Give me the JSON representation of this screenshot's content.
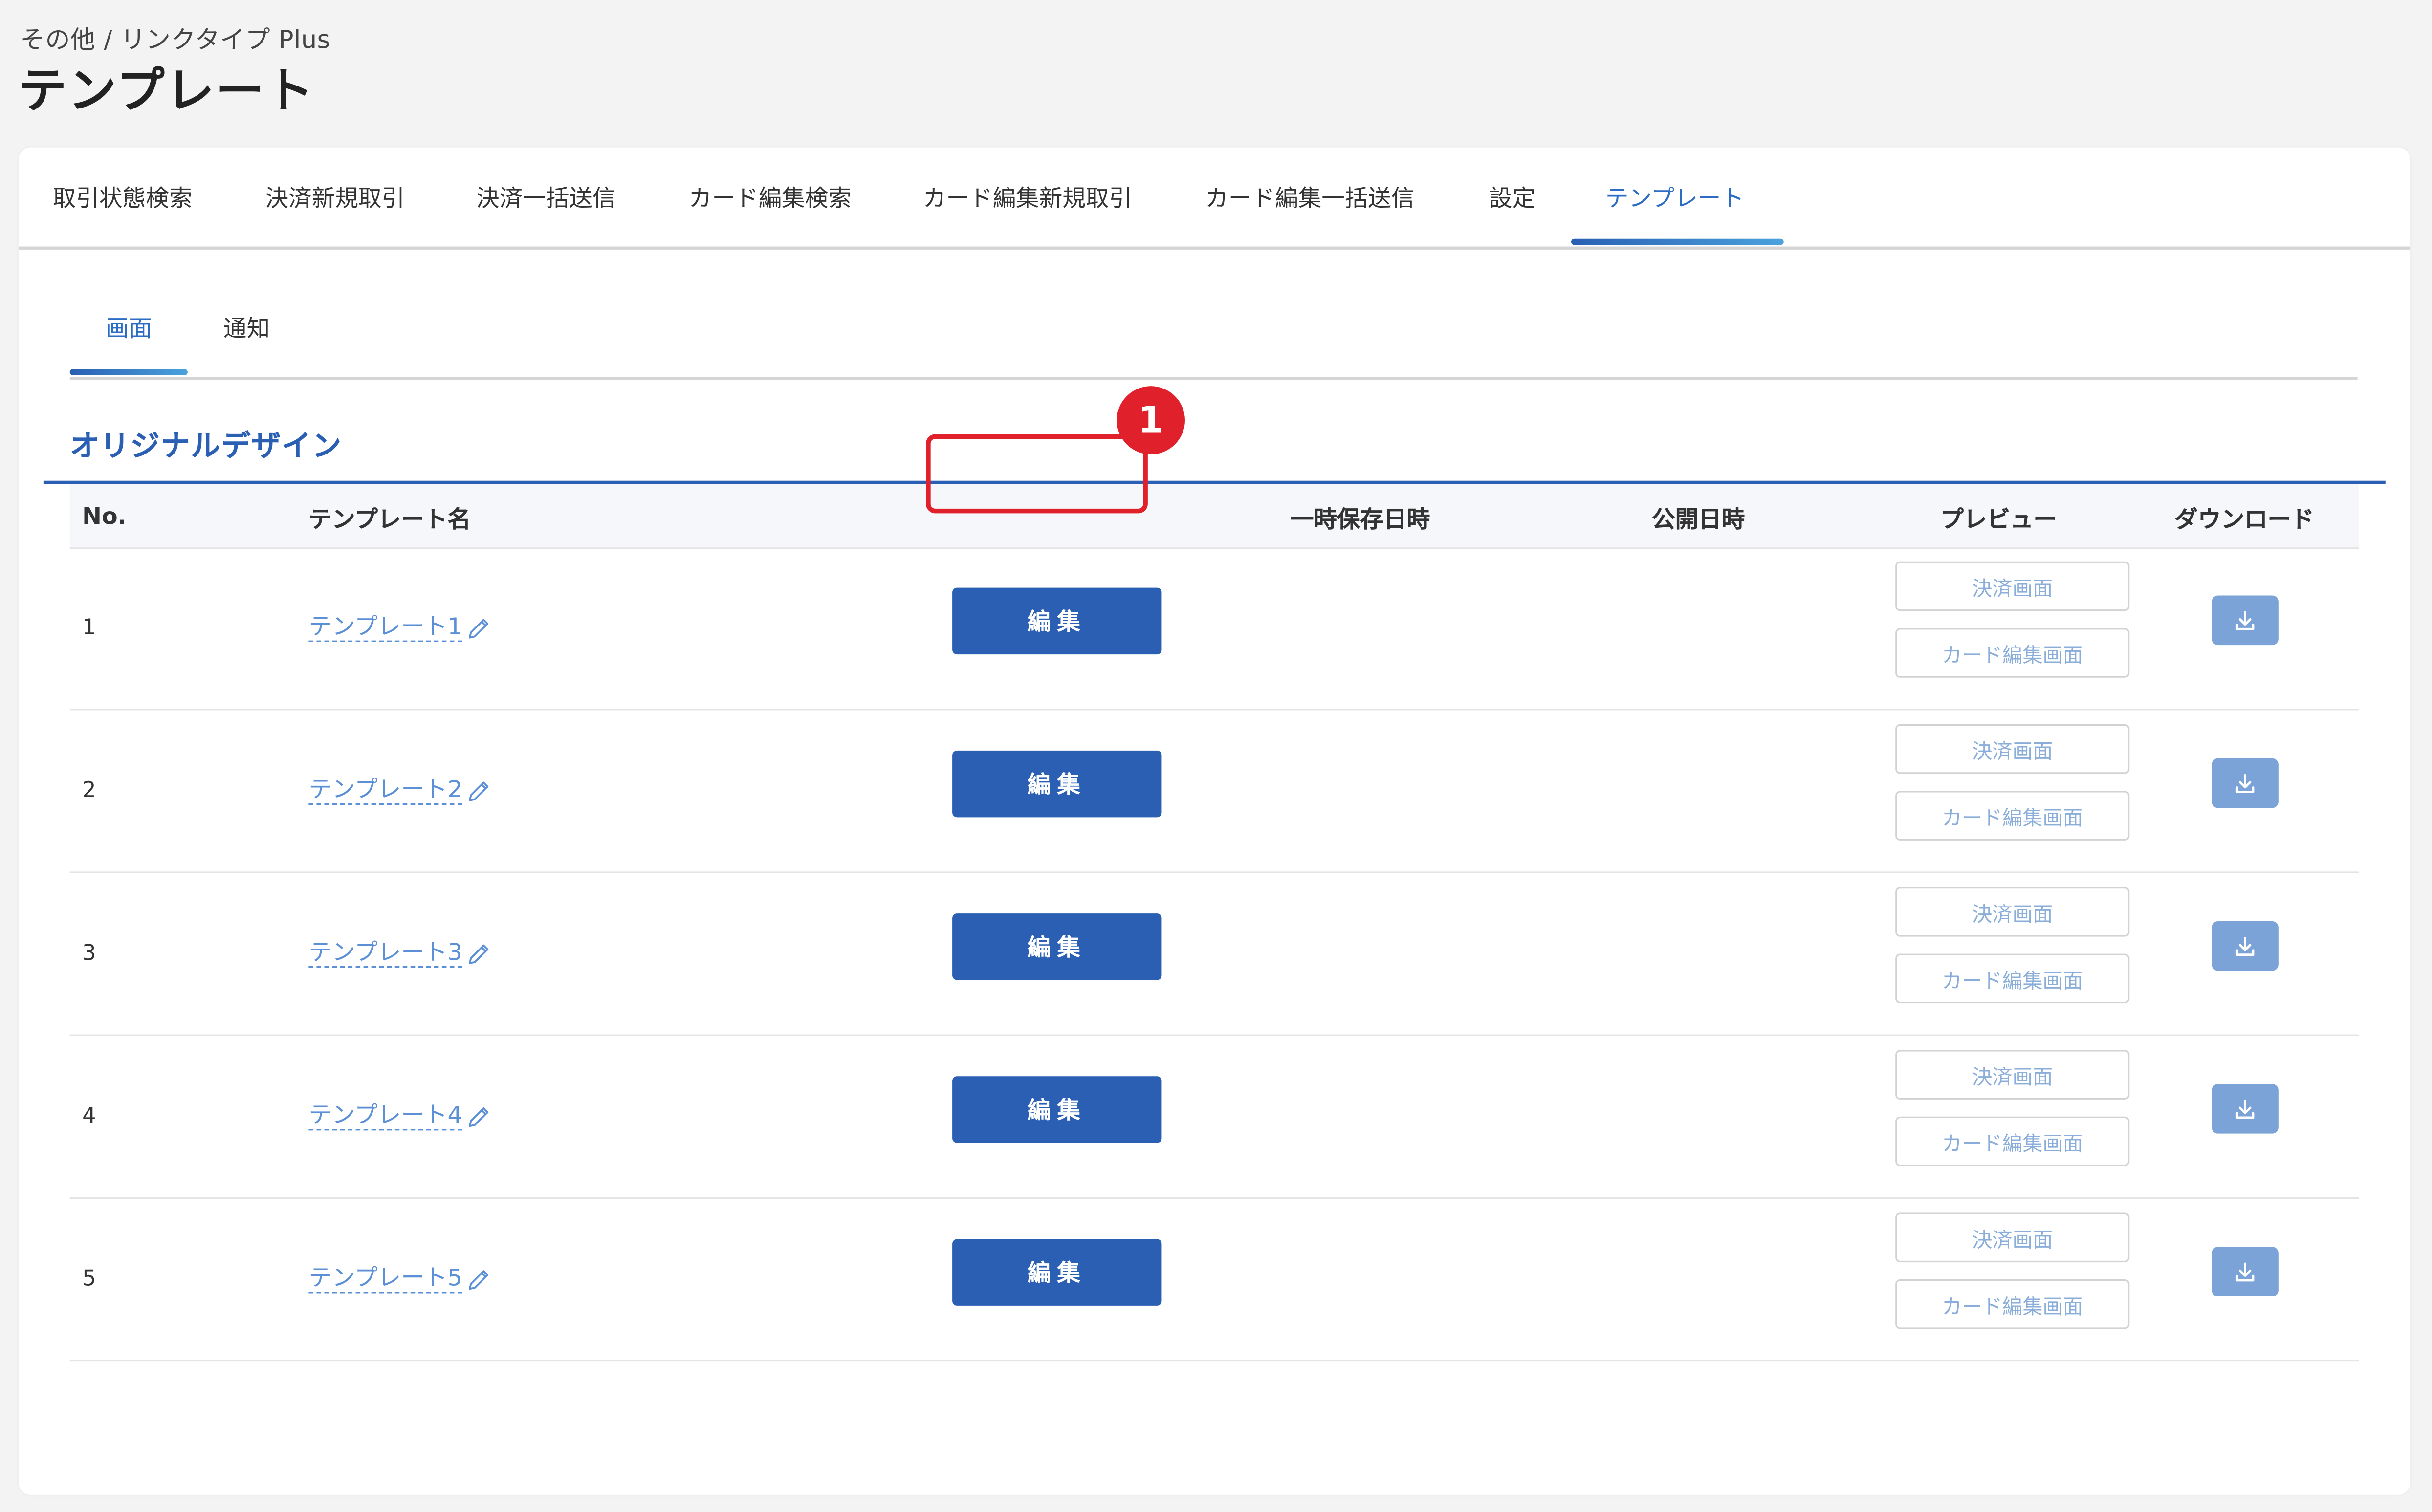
{
  "breadcrumb": "その他 / リンクタイプ Plus",
  "page_title": "テンプレート",
  "main_tabs": [
    "取引状態検索",
    "決済新規取引",
    "決済一括送信",
    "カード編集検索",
    "カード編集新規取引",
    "カード編集一括送信",
    "設定",
    "テンプレート"
  ],
  "main_tab_active": "テンプレート",
  "sub_tabs": [
    "画面",
    "通知"
  ],
  "sub_tab_active": "画面",
  "section_title": "オリジナルデザイン",
  "table": {
    "headers": {
      "no": "No.",
      "name": "テンプレート名",
      "temp_saved": "一時保存日時",
      "published": "公開日時",
      "preview": "プレビュー",
      "download": "ダウンロード"
    },
    "rows": [
      {
        "no": "1",
        "name": "テンプレート1",
        "edit": "編集",
        "preview_payment": "決済画面",
        "preview_card": "カード編集画面"
      },
      {
        "no": "2",
        "name": "テンプレート2",
        "edit": "編集",
        "preview_payment": "決済画面",
        "preview_card": "カード編集画面"
      },
      {
        "no": "3",
        "name": "テンプレート3",
        "edit": "編集",
        "preview_payment": "決済画面",
        "preview_card": "カード編集画面"
      },
      {
        "no": "4",
        "name": "テンプレート4",
        "edit": "編集",
        "preview_payment": "決済画面",
        "preview_card": "カード編集画面"
      },
      {
        "no": "5",
        "name": "テンプレート5",
        "edit": "編集",
        "preview_payment": "決済画面",
        "preview_card": "カード編集画面"
      }
    ]
  },
  "annotation": {
    "badge": "1",
    "color": "#e0202a"
  },
  "colors": {
    "accent": "#2a5fb3",
    "link": "#5b8fd6",
    "download_button": "#7ba3d8",
    "background": "#f3f3f3"
  },
  "icons": {
    "edit_name": "pencil-icon",
    "download": "download-icon"
  }
}
